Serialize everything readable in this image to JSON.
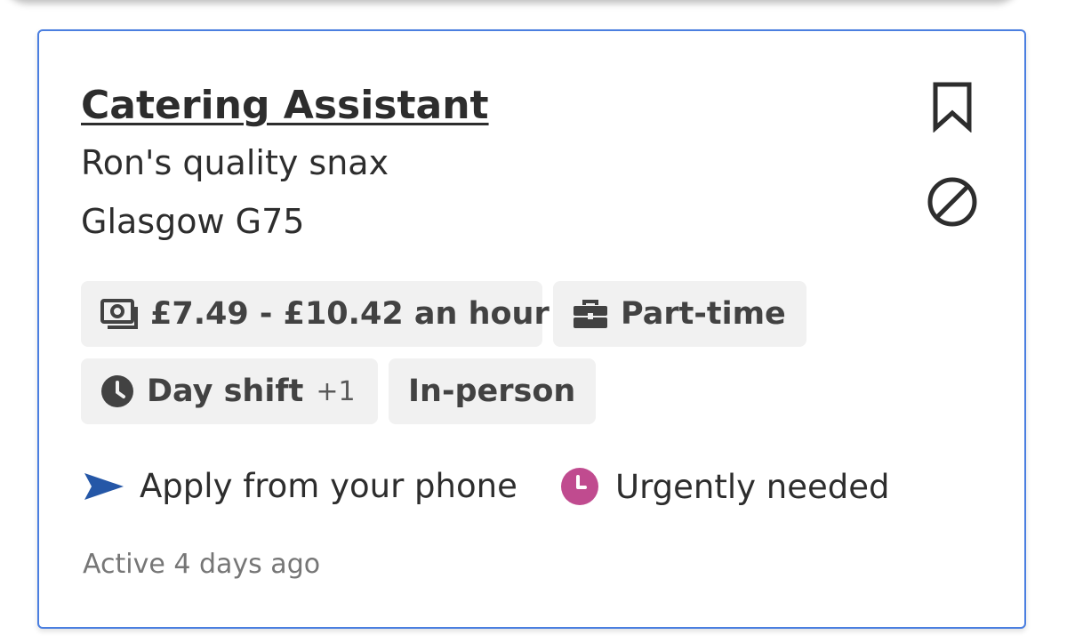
{
  "job": {
    "title": "Catering Assistant",
    "company": "Ron's quality snax",
    "location": "Glasgow G75"
  },
  "chips": {
    "salary": {
      "label": "£7.49 - £10.42 an hour",
      "icon": "money-icon"
    },
    "job_type": {
      "label": "Part-time",
      "icon": "briefcase-icon"
    },
    "shift": {
      "label": "Day shift",
      "extra": "+1",
      "icon": "clock-icon"
    },
    "work_mode": {
      "label": "In-person"
    }
  },
  "badges": {
    "apply": {
      "label": "Apply from your phone",
      "icon": "send-arrow-icon",
      "color": "#2557a7"
    },
    "urgent": {
      "label": "Urgently needed",
      "icon": "urgent-clock-icon",
      "color": "#c04b8f"
    }
  },
  "meta": {
    "active": "Active 4 days ago"
  },
  "actions": {
    "save_icon": "bookmark-icon",
    "hide_icon": "not-interested-icon"
  },
  "colors": {
    "card_border": "#4b7fe0",
    "chip_bg": "#f1f1f1",
    "text": "#2d2d2d",
    "muted": "#767676"
  }
}
